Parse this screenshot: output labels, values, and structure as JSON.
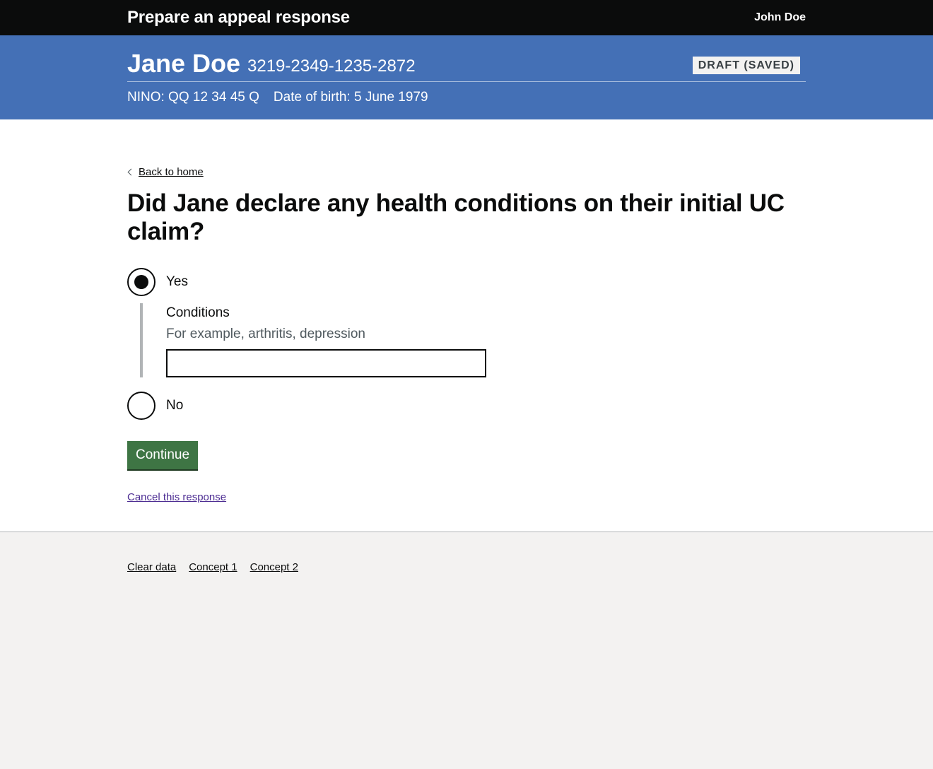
{
  "header": {
    "service_name": "Prepare an appeal response",
    "user_name": "John Doe"
  },
  "case": {
    "claimant_name": "Jane Doe",
    "claim_reference": "3219-2349-1235-2872",
    "status": "DRAFT (SAVED)",
    "nino": "NINO: QQ 12 34 45 Q",
    "date_of_birth": "Date of birth: 5 June 1979"
  },
  "main": {
    "back_link": "Back to home",
    "question": "Did Jane declare any health conditions on their initial UC claim?",
    "options": [
      {
        "label": "Yes",
        "selected": true
      },
      {
        "label": "No",
        "selected": false
      }
    ],
    "conditional": {
      "label": "Conditions",
      "hint": "For example, arthritis, depression",
      "value": ""
    },
    "continue_label": "Continue",
    "cancel_link": "Cancel this response"
  },
  "footer": {
    "links": [
      "Clear data",
      "Concept 1",
      "Concept 2"
    ]
  },
  "colors": {
    "header_bg": "#0b0c0c",
    "case_banner_bg": "#4470b6",
    "button_green": "#3e7544",
    "visited_link": "#4c2c92",
    "footer_bg": "#f3f2f1"
  }
}
